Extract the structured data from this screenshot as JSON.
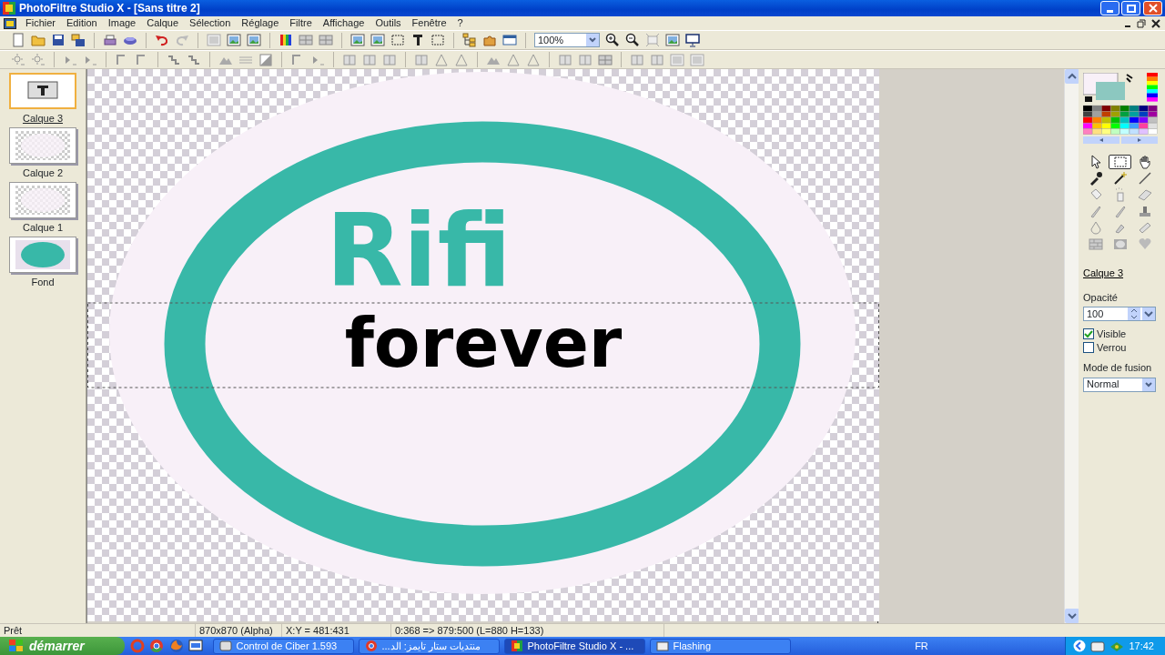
{
  "window": {
    "title": "PhotoFiltre Studio X - [Sans titre 2]"
  },
  "menu": [
    "Fichier",
    "Edition",
    "Image",
    "Calque",
    "Sélection",
    "Réglage",
    "Filtre",
    "Affichage",
    "Outils",
    "Fenêtre",
    "?"
  ],
  "zoom": {
    "value": "100%"
  },
  "layers": [
    {
      "name": "Calque 3",
      "kind": "text",
      "selected": true
    },
    {
      "name": "Calque 2",
      "kind": "transparent",
      "selected": false
    },
    {
      "name": "Calque 1",
      "kind": "transparent",
      "selected": false
    },
    {
      "name": "Fond",
      "kind": "fill",
      "selected": false
    }
  ],
  "canvas": {
    "texts": [
      {
        "text": "Rifi",
        "kind": "title"
      },
      {
        "text": "forever",
        "kind": "banner"
      }
    ]
  },
  "tools": [
    {
      "selected": false
    },
    {
      "selected": true
    },
    {
      "selected": false
    },
    {
      "selected": false
    },
    {
      "selected": false
    },
    {
      "selected": false
    },
    {
      "selected": false
    },
    {
      "selected": false
    },
    {
      "selected": false
    },
    {
      "selected": false
    },
    {
      "selected": false
    },
    {
      "selected": false
    },
    {
      "selected": false
    },
    {
      "selected": false
    },
    {
      "selected": false
    },
    {
      "selected": false
    },
    {
      "selected": false
    },
    {
      "selected": false
    }
  ],
  "layer_properties": {
    "layer_name": "Calque 3",
    "opacity_label": "Opacité",
    "opacity": "100",
    "options": [
      {
        "label": "Visible",
        "checked": true
      },
      {
        "label": "Verrou",
        "checked": false
      }
    ],
    "blend_label": "Mode de fusion",
    "blend_mode": "Normal"
  },
  "status_bar": [
    "Prêt",
    "870x870 (Alpha)",
    "X:Y = 481:431",
    "0:368 => 879:500 (L=880  H=133)"
  ],
  "taskbar": {
    "start": "démarrer",
    "tasks": [
      {
        "label": "Control de Ciber 1.593",
        "selected": false
      },
      {
        "label": "منتديات ستار تايمز: الد...",
        "selected": false
      },
      {
        "label": "PhotoFiltre Studio X - ...",
        "selected": true
      },
      {
        "label": "Flashing",
        "selected": false
      }
    ],
    "language": "FR",
    "clock": "17:42"
  }
}
